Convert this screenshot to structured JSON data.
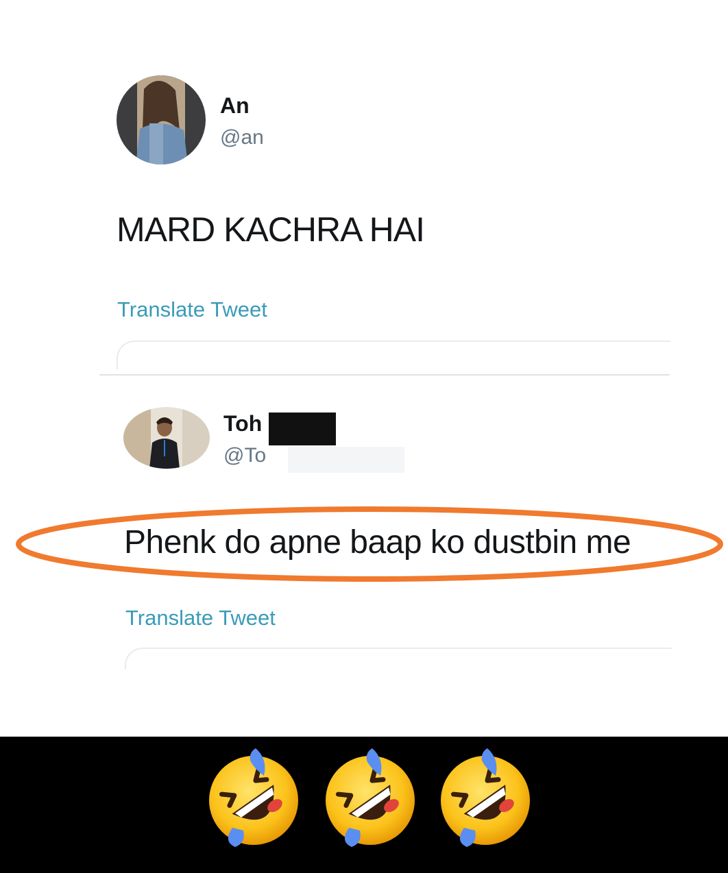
{
  "tweet1": {
    "name": "An",
    "handle": "@an",
    "text": "MARD KACHRA HAI",
    "translate_label": "Translate Tweet"
  },
  "tweet2": {
    "name": "Toh",
    "handle": "@To",
    "text": "Phenk do apne baap ko dustbin me",
    "translate_label": "Translate Tweet"
  },
  "colors": {
    "link": "#3a9bb8",
    "highlight": "#f07a2e",
    "text": "#14171a",
    "muted": "#657786"
  },
  "bottom_bar": {
    "emojis": [
      "rolling-on-floor-laughing-emoji",
      "rolling-on-floor-laughing-emoji",
      "rolling-on-floor-laughing-emoji"
    ]
  }
}
